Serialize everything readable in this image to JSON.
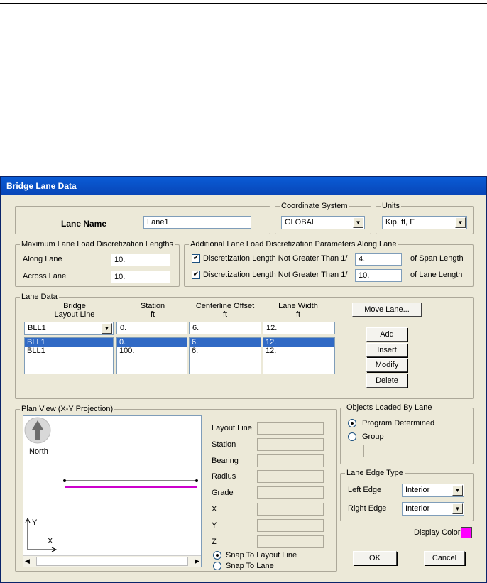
{
  "window": {
    "title": "Bridge Lane Data"
  },
  "lane_name": {
    "label": "Lane Name",
    "value": "Lane1"
  },
  "coordinate_system": {
    "legend": "Coordinate System",
    "value": "GLOBAL"
  },
  "units": {
    "legend": "Units",
    "value": "Kip, ft, F"
  },
  "max_lengths": {
    "legend": "Maximum Lane Load Discretization Lengths",
    "along_label": "Along Lane",
    "along_value": "10.",
    "across_label": "Across Lane",
    "across_value": "10."
  },
  "additional": {
    "legend": "Additional Lane Load Discretization Parameters Along Lane",
    "span_label": "Discretization Length Not Greater Than  1/",
    "span_value": "4.",
    "span_suffix": "of Span Length",
    "lane_label": "Discretization Length Not Greater Than  1/",
    "lane_value": "10.",
    "lane_suffix": "of Lane Length",
    "check_mark": "✔"
  },
  "lane_data": {
    "legend": "Lane Data",
    "col_headers": [
      "Bridge",
      "Layout Line",
      "Station",
      "ft",
      "Centerline Offset",
      "ft",
      "Lane Width",
      "ft"
    ],
    "edit_row": [
      "BLL1",
      "0.",
      "6.",
      "12."
    ],
    "rows": [
      [
        "BLL1",
        "0.",
        "6.",
        "12."
      ],
      [
        "BLL1",
        "100.",
        "6.",
        "12."
      ]
    ],
    "buttons": {
      "move": "Move Lane...",
      "add": "Add",
      "insert": "Insert",
      "modify": "Modify",
      "delete": "Delete"
    }
  },
  "plan_view": {
    "legend": "Plan View (X-Y Projection)",
    "north": "North",
    "axis_y": "Y",
    "axis_x": "X",
    "fields": [
      "Layout Line",
      "Station",
      "Bearing",
      "Radius",
      "Grade",
      "X",
      "Y",
      "Z"
    ],
    "snap_layout": "Snap To Layout Line",
    "snap_lane": "Snap To Lane",
    "lane_color": "#cc00cc"
  },
  "objects_loaded": {
    "legend": "Objects Loaded By Lane",
    "program": "Program Determined",
    "group": "Group"
  },
  "edge_type": {
    "legend": "Lane Edge Type",
    "left_label": "Left Edge",
    "left_value": "Interior",
    "right_label": "Right Edge",
    "right_value": "Interior"
  },
  "display_color": {
    "label": "Display Color",
    "color": "#ff00ff"
  },
  "footer": {
    "ok": "OK",
    "cancel": "Cancel"
  },
  "icons": {
    "combo_arrow": "▼",
    "scroll_left": "◀",
    "scroll_right": "▶"
  }
}
